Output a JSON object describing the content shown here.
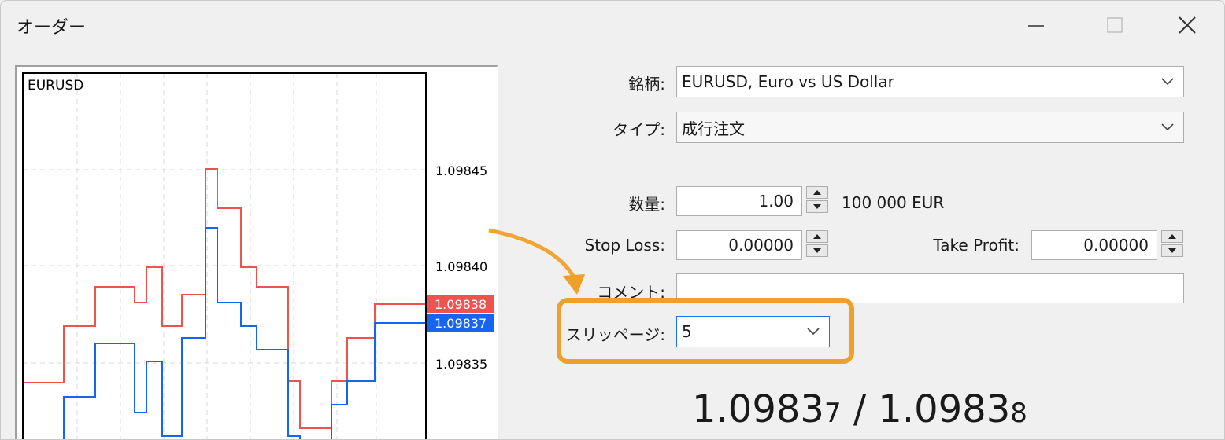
{
  "window": {
    "title": "オーダー"
  },
  "chart": {
    "symbol": "EURUSD",
    "price_ticks": [
      "1.09845",
      "1.09840",
      "1.09835"
    ],
    "ask_label": "1.09838",
    "bid_label": "1.09837",
    "colors": {
      "ask": "#ef5350",
      "bid": "#1565f0",
      "grid": "#d8d8d8"
    }
  },
  "form": {
    "symbol_label": "銘柄:",
    "symbol_value": "EURUSD, Euro vs US Dollar",
    "type_label": "タイプ:",
    "type_value": "成行注文",
    "volume_label": "数量:",
    "volume_value": "1.00",
    "volume_unit": "100 000 EUR",
    "stoploss_label": "Stop Loss:",
    "stoploss_value": "0.00000",
    "takeprofit_label": "Take Profit:",
    "takeprofit_value": "0.00000",
    "comment_label": "コメント:",
    "comment_value": "",
    "slippage_label": "スリッページ:",
    "slippage_value": "5"
  },
  "quote": {
    "bid_main": "1.0983",
    "bid_small": "7",
    "separator": "/",
    "ask_main": "1.0983",
    "ask_small": "8"
  },
  "highlight_color": "#f0a02a"
}
